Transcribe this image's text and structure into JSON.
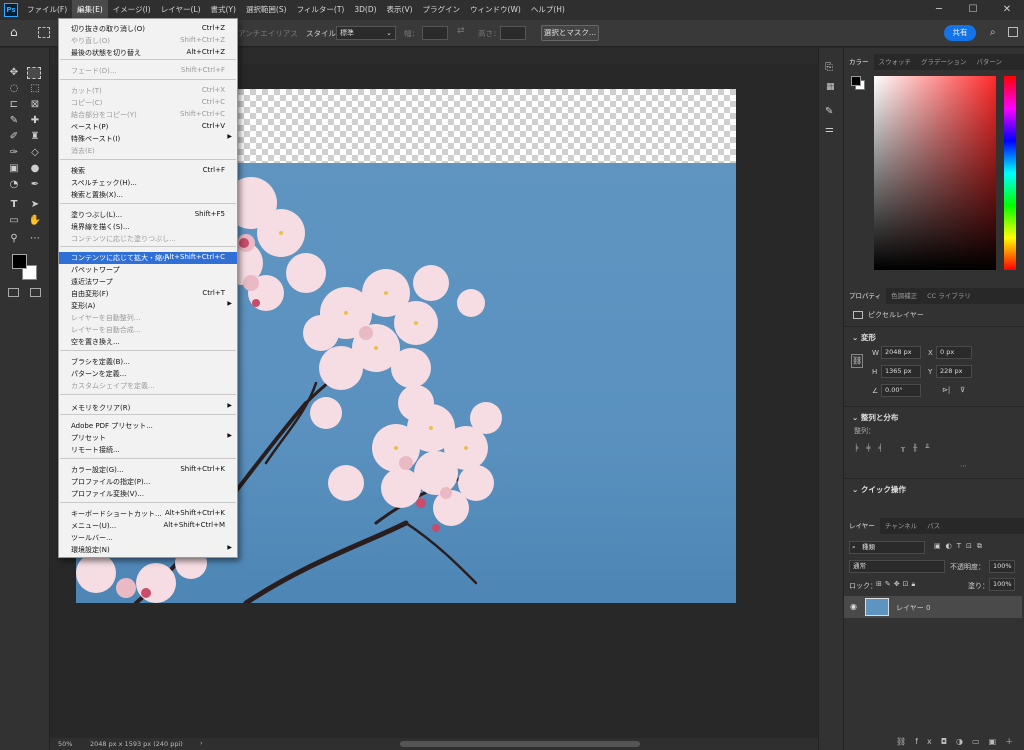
{
  "menubar": {
    "items": [
      "ファイル(F)",
      "編集(E)",
      "イメージ(I)",
      "レイヤー(L)",
      "書式(Y)",
      "選択範囲(S)",
      "フィルター(T)",
      "3D(D)",
      "表示(V)",
      "プラグイン",
      "ウィンドウ(W)",
      "ヘルプ(H)"
    ],
    "logo": "Ps"
  },
  "options_bar": {
    "antialias": "アンチエイリアス",
    "style_label": "スタイル：",
    "style_value": "標準",
    "width_label": "幅：",
    "height_label": "高さ：",
    "select_mask": "選択とマスク...",
    "share": "共有"
  },
  "edit_menu": {
    "items": [
      {
        "label": "切り抜きの取り消し(O)",
        "shortcut": "Ctrl+Z",
        "state": "enabled"
      },
      {
        "label": "やり直し(O)",
        "shortcut": "Shift+Ctrl+Z",
        "state": "disabled"
      },
      {
        "label": "最後の状態を切り替え",
        "shortcut": "Alt+Ctrl+Z",
        "state": "enabled"
      },
      {
        "label": "フェード(D)...",
        "shortcut": "Shift+Ctrl+F",
        "state": "disabled"
      },
      {
        "label": "カット(T)",
        "shortcut": "Ctrl+X",
        "state": "disabled"
      },
      {
        "label": "コピー(C)",
        "shortcut": "Ctrl+C",
        "state": "disabled"
      },
      {
        "label": "結合部分をコピー(Y)",
        "shortcut": "Shift+Ctrl+C",
        "state": "disabled"
      },
      {
        "label": "ペースト(P)",
        "shortcut": "Ctrl+V",
        "state": "enabled"
      },
      {
        "label": "特殊ペースト(I)",
        "shortcut": "",
        "state": "enabled",
        "submenu": true
      },
      {
        "label": "消去(E)",
        "shortcut": "",
        "state": "disabled"
      },
      {
        "label": "検索",
        "shortcut": "Ctrl+F",
        "state": "enabled"
      },
      {
        "label": "スペルチェック(H)...",
        "shortcut": "",
        "state": "enabled"
      },
      {
        "label": "検索と置換(X)...",
        "shortcut": "",
        "state": "enabled"
      },
      {
        "label": "塗りつぶし(L)...",
        "shortcut": "Shift+F5",
        "state": "enabled"
      },
      {
        "label": "境界線を描く(S)...",
        "shortcut": "",
        "state": "enabled"
      },
      {
        "label": "コンテンツに応じた塗りつぶし...",
        "shortcut": "",
        "state": "disabled"
      },
      {
        "label": "コンテンツに応じて拡大・縮小",
        "shortcut": "Alt+Shift+Ctrl+C",
        "state": "highlighted"
      },
      {
        "label": "パペットワープ",
        "shortcut": "",
        "state": "enabled"
      },
      {
        "label": "遠近法ワープ",
        "shortcut": "",
        "state": "enabled"
      },
      {
        "label": "自由変形(F)",
        "shortcut": "Ctrl+T",
        "state": "enabled"
      },
      {
        "label": "変形(A)",
        "shortcut": "",
        "state": "enabled",
        "submenu": true
      },
      {
        "label": "レイヤーを自動整列...",
        "shortcut": "",
        "state": "disabled"
      },
      {
        "label": "レイヤーを自動合成...",
        "shortcut": "",
        "state": "disabled"
      },
      {
        "label": "空を置き換え...",
        "shortcut": "",
        "state": "enabled"
      },
      {
        "label": "ブラシを定義(B)...",
        "shortcut": "",
        "state": "enabled"
      },
      {
        "label": "パターンを定義...",
        "shortcut": "",
        "state": "enabled"
      },
      {
        "label": "カスタムシェイプを定義...",
        "shortcut": "",
        "state": "disabled"
      },
      {
        "label": "メモリをクリア(R)",
        "shortcut": "",
        "state": "enabled",
        "submenu": true
      },
      {
        "label": "Adobe PDF プリセット...",
        "shortcut": "",
        "state": "enabled"
      },
      {
        "label": "プリセット",
        "shortcut": "",
        "state": "enabled",
        "submenu": true
      },
      {
        "label": "リモート接続...",
        "shortcut": "",
        "state": "enabled"
      },
      {
        "label": "カラー設定(G)...",
        "shortcut": "Shift+Ctrl+K",
        "state": "enabled"
      },
      {
        "label": "プロファイルの指定(P)...",
        "shortcut": "",
        "state": "enabled"
      },
      {
        "label": "プロファイル変換(V)...",
        "shortcut": "",
        "state": "enabled"
      },
      {
        "label": "キーボードショートカット...",
        "shortcut": "Alt+Shift+Ctrl+K",
        "state": "enabled"
      },
      {
        "label": "メニュー(U)...",
        "shortcut": "Alt+Shift+Ctrl+M",
        "state": "enabled"
      },
      {
        "label": "ツールバー...",
        "shortcut": "",
        "state": "enabled"
      },
      {
        "label": "環境設定(N)",
        "shortcut": "",
        "state": "enabled",
        "submenu": true
      }
    ]
  },
  "color_panel": {
    "tabs": [
      "カラー",
      "スウォッチ",
      "グラデーション",
      "パターン"
    ],
    "accent": "#ff2a2a"
  },
  "properties_panel": {
    "tabs": [
      "プロパティ",
      "色調補正",
      "CC ライブラリ"
    ],
    "layer_type": "ピクセルレイヤー",
    "transform_title": "変形",
    "w_label": "W",
    "w_value": "2048 px",
    "h_label": "H",
    "h_value": "1365 px",
    "x_label": "X",
    "x_value": "0 px",
    "y_label": "Y",
    "y_value": "228 px",
    "angle_value": "0.00°",
    "align_title": "整列と分布",
    "align_label": "整列：",
    "quick_title": "クイック操作"
  },
  "layers_panel": {
    "tabs": [
      "レイヤー",
      "チャンネル",
      "パス"
    ],
    "filter_kind": "種類",
    "blend_mode": "通常",
    "opacity_label": "不透明度：",
    "opacity_value": "100%",
    "lock_label": "ロック：",
    "fill_label": "塗り：",
    "fill_value": "100%",
    "layer_name": "レイヤー 0"
  },
  "status": {
    "zoom": "50%",
    "doc_info": "2048 px x 1593 px (240 ppi)"
  }
}
